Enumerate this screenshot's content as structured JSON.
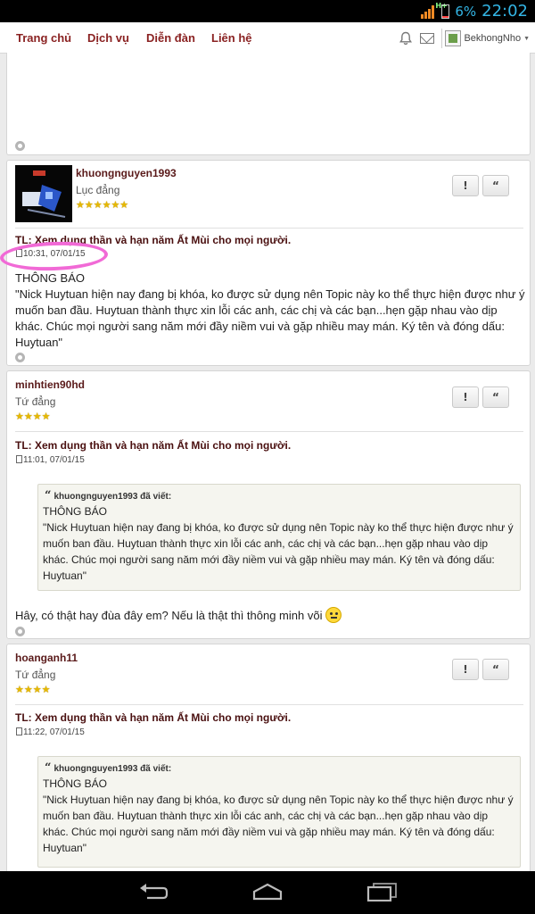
{
  "status_bar": {
    "network": "H+",
    "battery_pct": "6%",
    "time": "22:02"
  },
  "nav": {
    "items": [
      "Trang chủ",
      "Dịch vụ",
      "Diễn đàn",
      "Liên hệ"
    ],
    "username": "BekhongNho"
  },
  "posts": [
    {
      "username": "khuongnguyen1993",
      "rank": "Lục đẳng",
      "stars": "★★★★★★",
      "report": "!",
      "quote": "“",
      "title": "TL: Xem dụng thần và hạn năm Ất Mùi cho mọi người.",
      "date": "10:31, 07/01/15",
      "body": [
        "THÔNG BÁO",
        "\"Nick Huytuan hiện nay đang bị khóa, ko được sử dụng nên Topic này ko thể thực hiện được như ý",
        "muốn ban đầu. Huytuan thành thực xin lỗi các anh, các chị và các bạn...hẹn gặp nhau vào dịp",
        "khác. Chúc mọi người sang năm mới đầy niềm vui và gặp nhiều may mán. Ký tên và đóng dấu:",
        "Huytuan\""
      ]
    },
    {
      "username": "minhtien90hd",
      "rank": "Tứ đẳng",
      "stars": "★★★★",
      "report": "!",
      "quote": "“",
      "title": "TL: Xem dụng thần và hạn năm Ất Mùi cho mọi người.",
      "date": "11:01, 07/01/15",
      "quote_author": "khuongnguyen1993 đã viết:",
      "quote_body": [
        "THÔNG BÁO",
        "\"Nick Huytuan hiện nay đang bị khóa, ko được sử dụng nên Topic này ko thể thực hiện được như ý",
        "muốn ban đầu. Huytuan thành thực xin lỗi các anh, các chị và các bạn...hẹn gặp nhau vào dịp",
        "khác. Chúc mọi người sang năm mới đầy niềm vui và gặp nhiều may mán. Ký tên và đóng dấu:",
        "Huytuan\""
      ],
      "reply": "Hây, có thật hay đùa đây em? Nếu là thật thì thông minh või"
    },
    {
      "username": "hoanganh11",
      "rank": "Tứ đẳng",
      "stars": "★★★★",
      "report": "!",
      "quote": "“",
      "title": "TL: Xem dụng thần và hạn năm Ất Mùi cho mọi người.",
      "date": "11:22, 07/01/15",
      "quote_author": "khuongnguyen1993 đã viết:",
      "quote_body": [
        "THÔNG BÁO",
        "\"Nick Huytuan hiện nay đang bị khóa, ko được sử dụng nên Topic này ko thể thực hiện được như ý",
        "muốn ban đầu. Huytuan thành thực xin lỗi các anh, các chị và các bạn...hẹn gặp nhau vào dịp",
        "khác. Chúc mọi người sang năm mới đầy niềm vui và gặp nhiều may mán. Ký tên và đóng dấu:",
        "Huytuan\""
      ]
    }
  ],
  "colors": {
    "accent": "#8a2222",
    "highlight": "#f16ad6",
    "status_text": "#33b5e5"
  }
}
